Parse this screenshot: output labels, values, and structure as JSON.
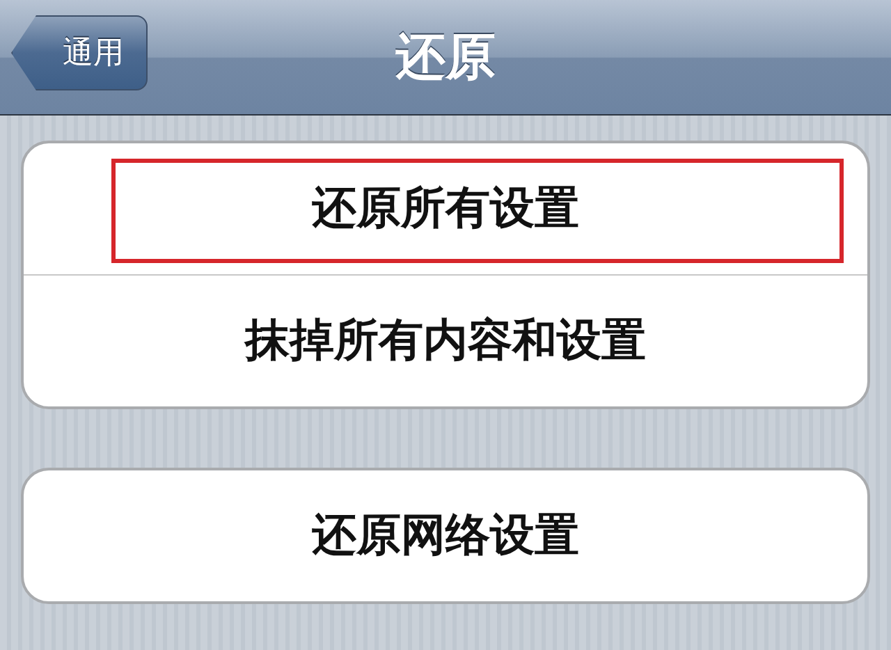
{
  "nav_bar": {
    "back_button": "通用",
    "title": "还原"
  },
  "groups": [
    {
      "items": [
        {
          "label": "还原所有设置",
          "highlighted": true
        },
        {
          "label": "抹掉所有内容和设置",
          "highlighted": false
        }
      ]
    },
    {
      "items": [
        {
          "label": "还原网络设置",
          "highlighted": false
        }
      ]
    }
  ]
}
